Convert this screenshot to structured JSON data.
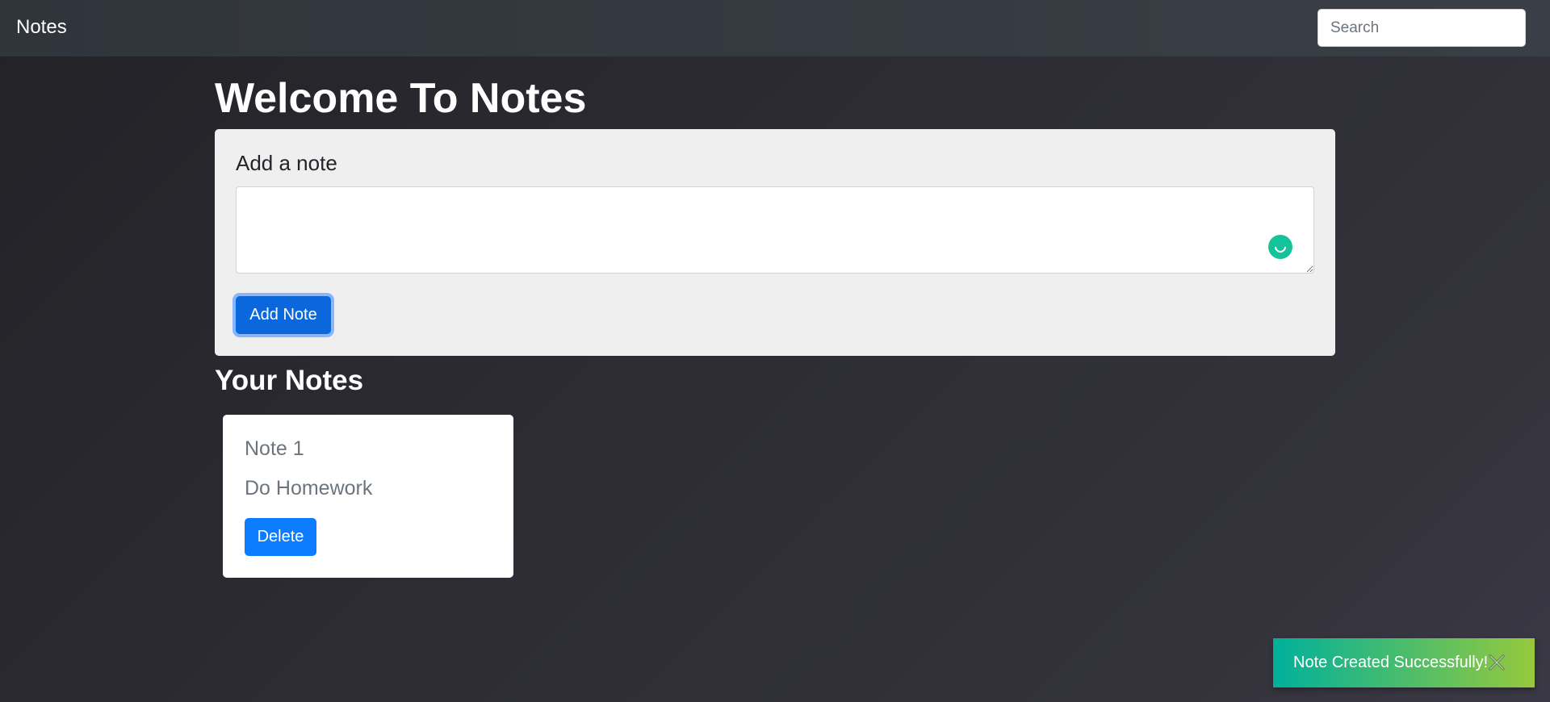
{
  "navbar": {
    "brand": "Notes",
    "search_placeholder": "Search"
  },
  "main": {
    "heading": "Welcome To Notes",
    "add_note": {
      "label": "Add a note",
      "textarea_value": "",
      "button_label": "Add Note"
    },
    "notes_heading": "Your Notes",
    "notes": [
      {
        "title": "Note 1",
        "text": "Do Homework",
        "delete_label": "Delete"
      }
    ]
  },
  "toast": {
    "message": "Note Created Successfully!"
  },
  "colors": {
    "primary": "#0d7cff",
    "grammarly": "#15c39a",
    "toast_start": "#00b09b",
    "toast_end": "#96c93d"
  },
  "icons": {
    "grammar": "grammarly-icon",
    "toast_close": "close-icon"
  }
}
